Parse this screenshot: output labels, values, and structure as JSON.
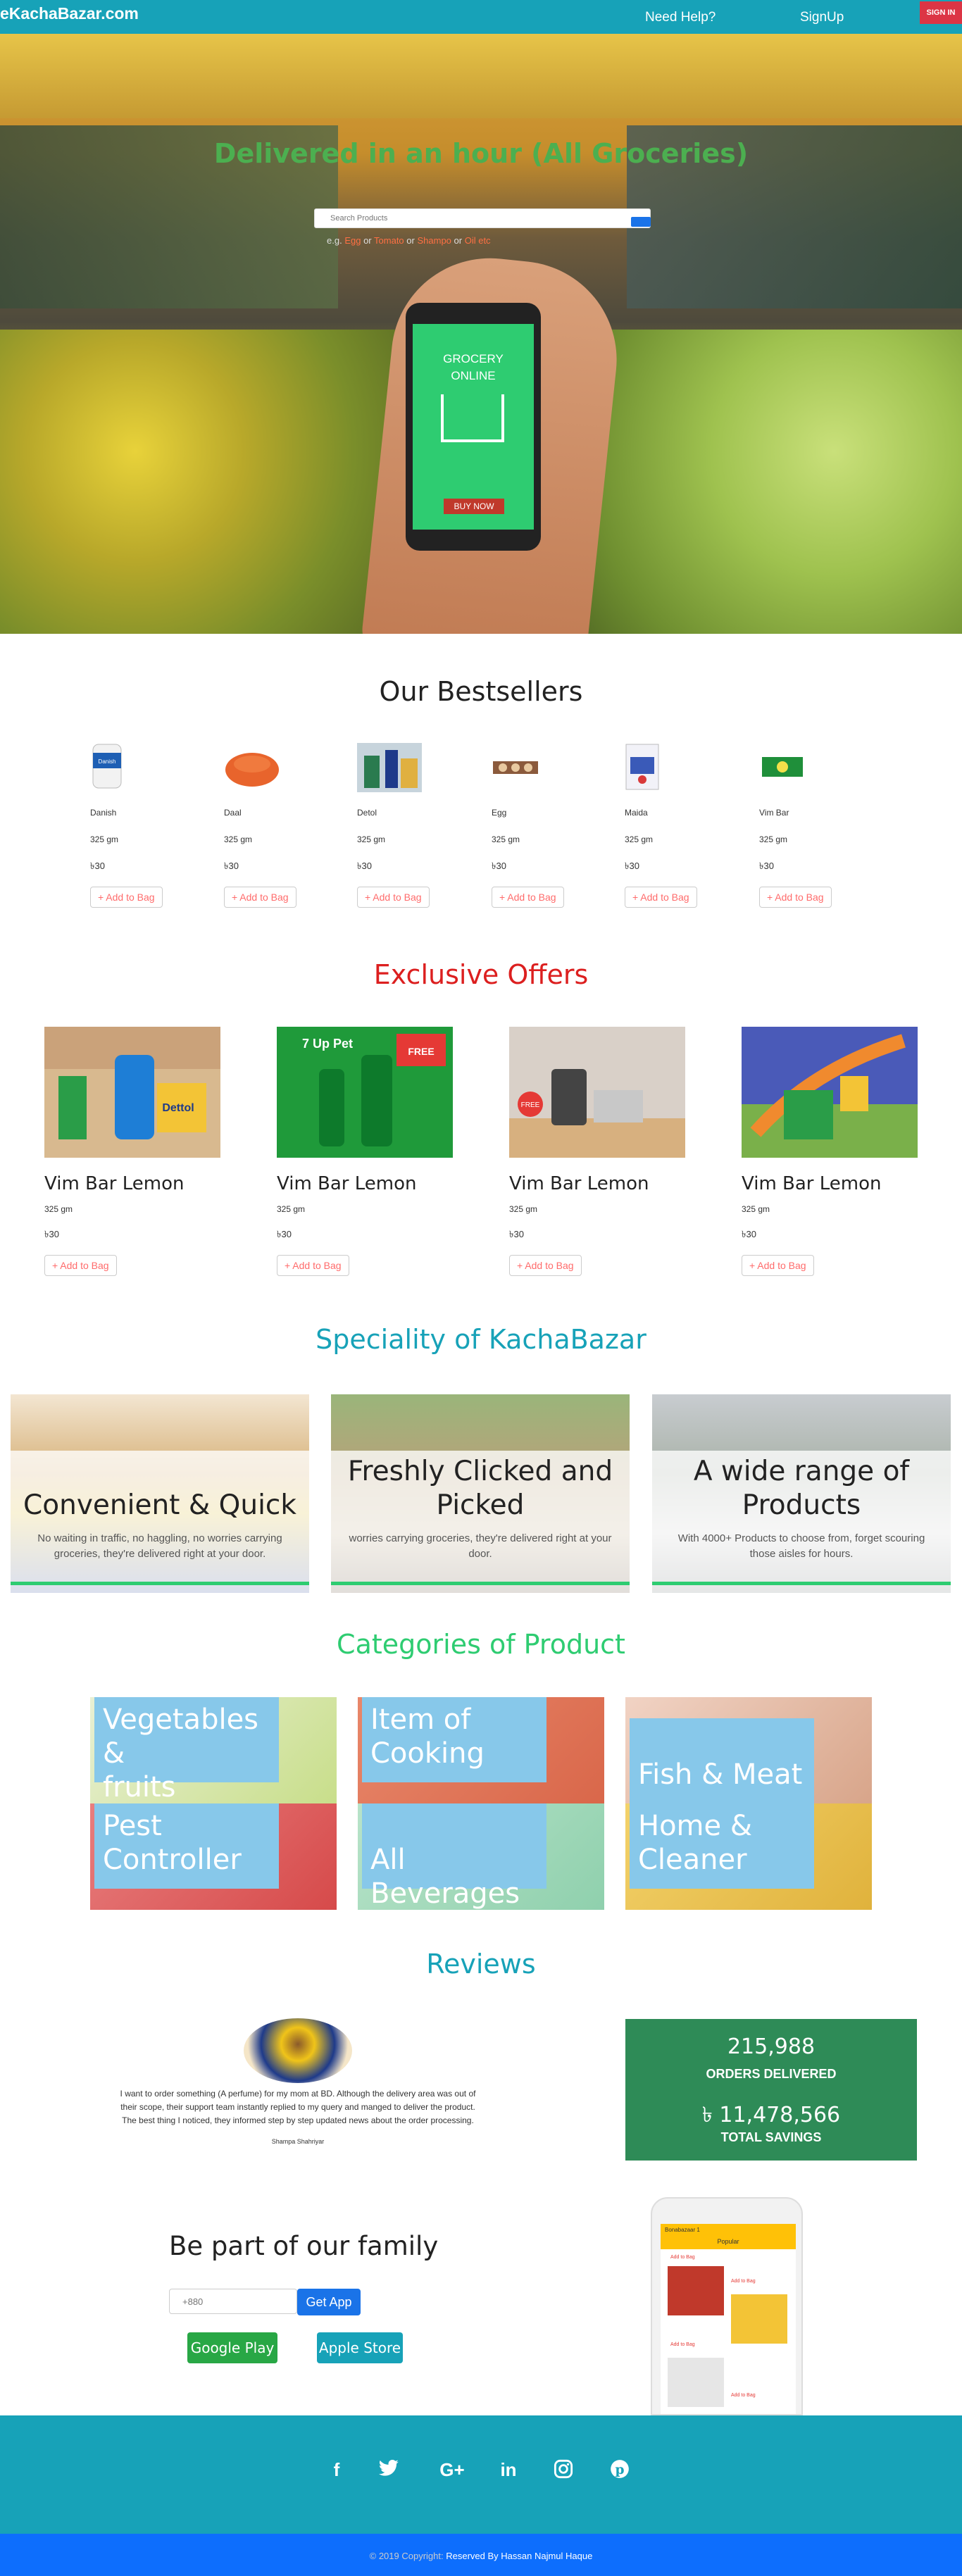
{
  "nav": {
    "brand": "eKachaBazar.com",
    "help": "Need Help?",
    "signup": "SignUp",
    "signin": "SIGN IN"
  },
  "hero": {
    "title": "Delivered in an hour (All Groceries)",
    "search_placeholder": "Search Products",
    "hint_prefix": "e.g.",
    "hint_items": [
      "Egg",
      "Tomato",
      "Shampo",
      "Oil etc"
    ],
    "hint_joiner": "or",
    "phone_line1": "GROCERY",
    "phone_line2": "ONLINE",
    "phone_button": "BUY NOW"
  },
  "bestsellers": {
    "title": "Our Bestsellers",
    "add_label": "+ Add to Bag",
    "items": [
      {
        "name": "Danish",
        "qty": "325 gm",
        "price": "৳30"
      },
      {
        "name": "Daal",
        "qty": "325 gm",
        "price": "৳30"
      },
      {
        "name": "Detol",
        "qty": "325 gm",
        "price": "৳30"
      },
      {
        "name": "Egg",
        "qty": "325 gm",
        "price": "৳30"
      },
      {
        "name": "Maida",
        "qty": "325 gm",
        "price": "৳30"
      },
      {
        "name": "Vim Bar",
        "qty": "325 gm",
        "price": "৳30"
      }
    ]
  },
  "offers": {
    "title": "Exclusive Offers",
    "add_label": "+ Add to Bag",
    "items": [
      {
        "name": "Vim Bar Lemon",
        "qty": "325 gm",
        "price": "৳30"
      },
      {
        "name": "Vim Bar Lemon",
        "qty": "325 gm",
        "price": "৳30"
      },
      {
        "name": "Vim Bar Lemon",
        "qty": "325 gm",
        "price": "৳30"
      },
      {
        "name": "Vim Bar Lemon",
        "qty": "325 gm",
        "price": "৳30"
      }
    ]
  },
  "speciality": {
    "title": "Speciality of KachaBazar",
    "cards": [
      {
        "heading": "Convenient & Quick",
        "desc": "No waiting in traffic, no haggling, no worries carrying groceries, they're delivered right at your door."
      },
      {
        "heading": "Freshly Clicked and Picked",
        "desc": "worries carrying groceries, they're delivered right at your door."
      },
      {
        "heading": "A wide range of Products",
        "desc": "With 4000+ Products to choose from, forget scouring those aisles for hours."
      }
    ]
  },
  "categories": {
    "title": "Categories of Product",
    "items": [
      {
        "line1": "Vegetables &",
        "line2": "fruits"
      },
      {
        "line1": "Item of",
        "line2": "Cooking"
      },
      {
        "line1": "",
        "line2": "Fish & Meat"
      },
      {
        "line1": "Pest",
        "line2": "Controller"
      },
      {
        "line1": "",
        "line2": "All Beverages"
      },
      {
        "line1": "Home &",
        "line2": "Cleaner"
      }
    ]
  },
  "reviews": {
    "title": "Reviews",
    "text": "I want to order something (A perfume) for my mom at BD. Although the delivery area was out of their scope, their support team instantly replied to my query and manged to deliver the product. The best thing I noticed, they informed step by step updated news about the order processing.",
    "author": "Shampa Shahriyar",
    "orders_value": "215,988",
    "orders_label": "ORDERS DELIVERED",
    "savings_value": "৳ 11,478,566",
    "savings_label": "TOTAL SAVINGS"
  },
  "family": {
    "title": "Be part of our family",
    "phone_placeholder": "+880",
    "get_app": "Get App",
    "google_play": "Google Play",
    "apple_store": "Apple Store",
    "app_header": "Bonabazaar 1",
    "app_popular": "Popular",
    "app_add": "Add to Bag"
  },
  "footer": {
    "copyright_prefix": "© 2019 Copyright:",
    "copyright_owner": "Reserved By Hassan Najmul Haque"
  }
}
